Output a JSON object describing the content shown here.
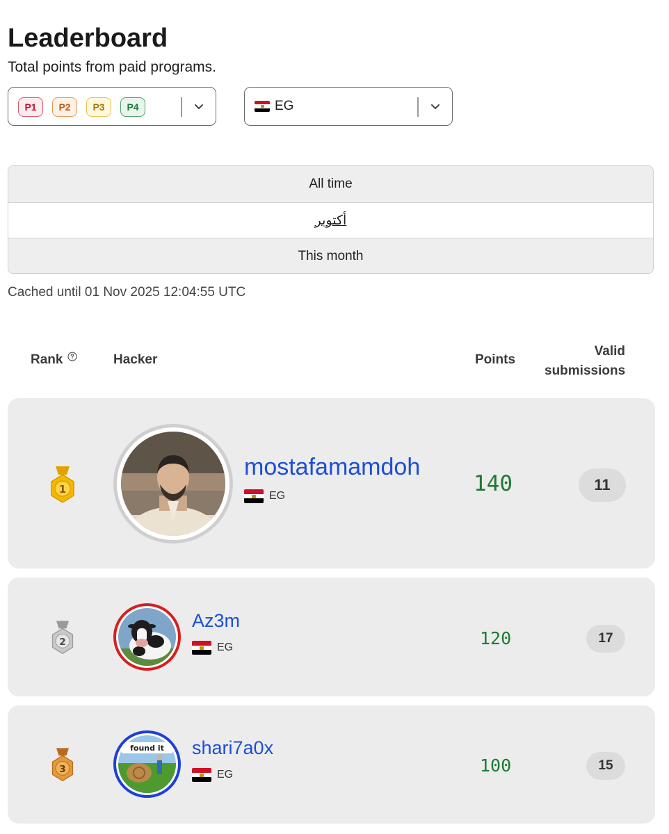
{
  "page": {
    "title": "Leaderboard",
    "subtitle": "Total points from paid programs."
  },
  "filters": {
    "priorities": [
      "P1",
      "P2",
      "P3",
      "P4"
    ],
    "country": {
      "flag_icon": "egypt-flag-icon",
      "value": "EG"
    }
  },
  "period": {
    "options": [
      "All time",
      "أكتوبر",
      "This month"
    ]
  },
  "cached_text": "Cached until 01 Nov 2025 12:04:55 UTC",
  "table": {
    "headers": {
      "rank": "Rank",
      "hacker": "Hacker",
      "points": "Points",
      "valid_line1": "Valid",
      "valid_line2": "submissions"
    },
    "rows": [
      {
        "rank": "1",
        "medal": "gold-medal-icon",
        "username": "mostafamamdoh",
        "country": "EG",
        "points": "140",
        "valid_submissions": "11",
        "ring_color": "#cfcfcf"
      },
      {
        "rank": "2",
        "medal": "silver-medal-icon",
        "username": "Az3m",
        "country": "EG",
        "points": "120",
        "valid_submissions": "17",
        "ring_color": "#d81e1e"
      },
      {
        "rank": "3",
        "medal": "bronze-medal-icon",
        "username": "shari7a0x",
        "country": "EG",
        "points": "100",
        "valid_submissions": "15",
        "ring_color": "#1e3fd8"
      }
    ],
    "avatar_overlay_text": "found it"
  }
}
